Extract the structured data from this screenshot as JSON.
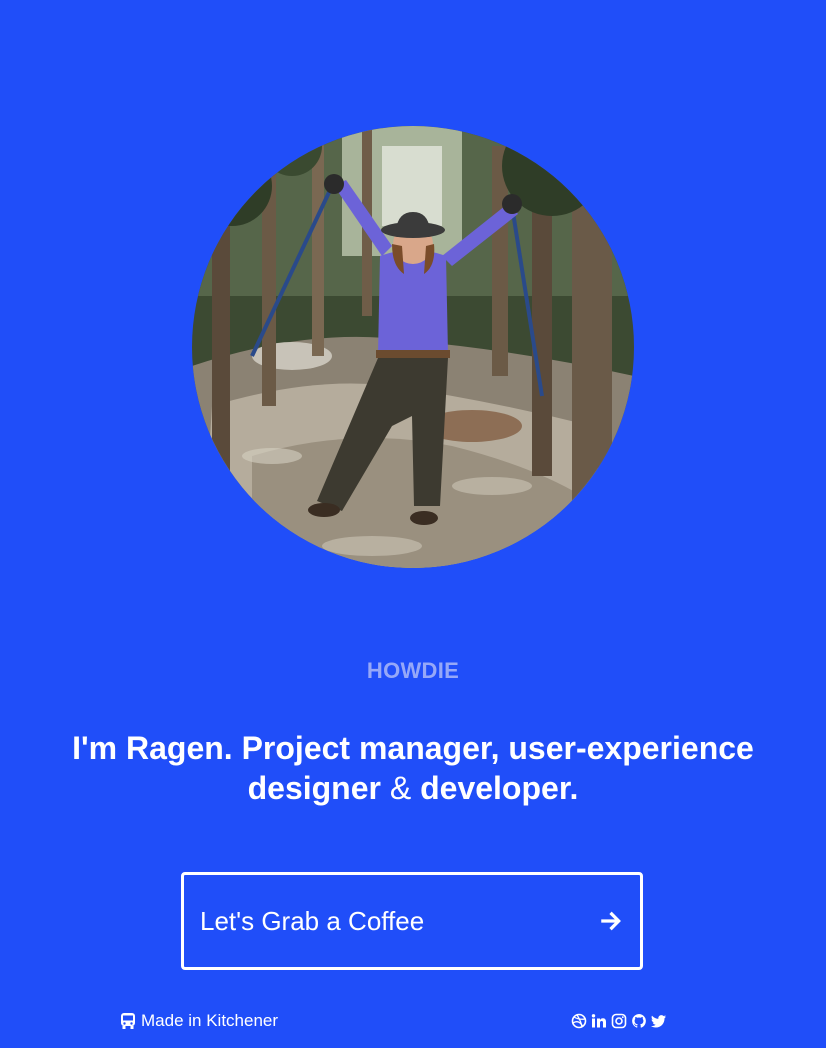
{
  "hero": {
    "eyebrow": "HOWDIE",
    "headline_part1": "I'm Ragen. Project manager, user-experience designer",
    "headline_amp": "&",
    "headline_part2": "developer."
  },
  "cta": {
    "label": "Let's Grab a Coffee",
    "icon": "arrow-right-icon"
  },
  "footer": {
    "location_icon": "bus-icon",
    "location_text": "Made in Kitchener",
    "social_icons": [
      "dribbble-icon",
      "linkedin-icon",
      "instagram-icon",
      "github-icon",
      "twitter-icon"
    ]
  },
  "colors": {
    "background": "#204ef9",
    "eyebrow": "#96a8f8",
    "text": "#ffffff"
  }
}
